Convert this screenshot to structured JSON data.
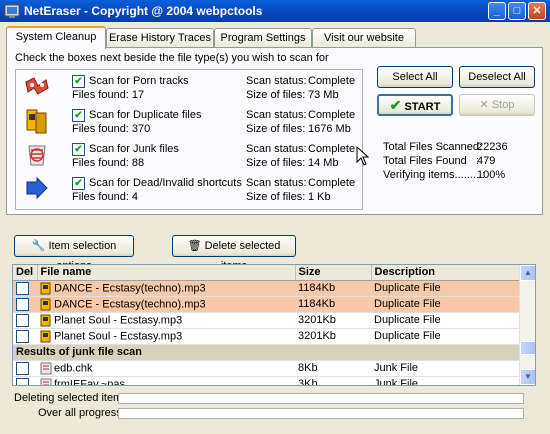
{
  "window": {
    "title": "NetEraser - Copyright @ 2004 webpctools"
  },
  "tabs": [
    {
      "label": "System Cleanup"
    },
    {
      "label": "Erase History Traces"
    },
    {
      "label": "Program Settings"
    },
    {
      "label": "Visit our website"
    }
  ],
  "cleanup": {
    "instruction": "Check the boxes next beside the file type(s) you wish to scan for",
    "scans": [
      {
        "label": "Scan for Porn tracks",
        "found_label": "Files found: 17",
        "status_label": "Scan status:",
        "status": "Complete",
        "size_label": "Size of files:",
        "size": "73 Mb",
        "icon": "porn-tracks-icon"
      },
      {
        "label": "Scan for Duplicate files",
        "found_label": "Files found: 370",
        "status_label": "Scan status:",
        "status": "Complete",
        "size_label": "Size of files:",
        "size": "1676 Mb",
        "icon": "duplicate-files-icon"
      },
      {
        "label": "Scan for Junk files",
        "found_label": "Files found: 88",
        "status_label": "Scan status:",
        "status": "Complete",
        "size_label": "Size of files:",
        "size": "14 Mb",
        "icon": "junk-files-icon"
      },
      {
        "label": "Scan for Dead/Invalid shortcuts",
        "found_label": "Files found: 4",
        "status_label": "Scan status:",
        "status": "Complete",
        "size_label": "Size of files:",
        "size": "1 Kb",
        "icon": "shortcut-icon"
      }
    ],
    "buttons": {
      "select_all": "Select All",
      "deselect_all": "Deselect All",
      "start": "START",
      "stop": "Stop"
    },
    "stats": [
      {
        "label": "Total Files Scanned:",
        "value": "22236"
      },
      {
        "label": "Total Files Found   :",
        "value": "479"
      },
      {
        "label": "Verifying items.........:",
        "value": "100%"
      }
    ]
  },
  "actions": {
    "item_selection": "Item selection options",
    "delete_selected": "Delete selected items"
  },
  "table": {
    "columns": [
      "Del",
      "File name",
      "Size",
      "Description"
    ],
    "rows": [
      {
        "name": "DANCE - Ecstasy(techno).mp3",
        "size": "1184Kb",
        "desc": "Duplicate File",
        "highlight": true,
        "type": "mp3"
      },
      {
        "name": "DANCE - Ecstasy(techno).mp3",
        "size": "1184Kb",
        "desc": "Duplicate File",
        "highlight": true,
        "type": "mp3"
      },
      {
        "name": "Planet Soul - Ecstasy.mp3",
        "size": "3201Kb",
        "desc": "Duplicate File",
        "highlight": false,
        "type": "mp3"
      },
      {
        "name": "Planet Soul - Ecstasy.mp3",
        "size": "3201Kb",
        "desc": "Duplicate File",
        "highlight": false,
        "type": "mp3"
      }
    ],
    "group_header": "Results of junk file scan",
    "junk_rows": [
      {
        "name": "edb.chk",
        "size": "8Kb",
        "desc": "Junk File",
        "type": "junk"
      },
      {
        "name": "frmIEFav.~pas",
        "size": "3Kb",
        "desc": "Junk File",
        "type": "junk"
      }
    ]
  },
  "footer": {
    "deleting_label": "Deleting selected items:",
    "overall_label": "Over all progress:"
  },
  "colors": {
    "titlebar": "#0a5fd8",
    "highlight_row": "#f8c9a8",
    "group_row": "#d7d2bc",
    "tab_accent": "#f0a030"
  }
}
